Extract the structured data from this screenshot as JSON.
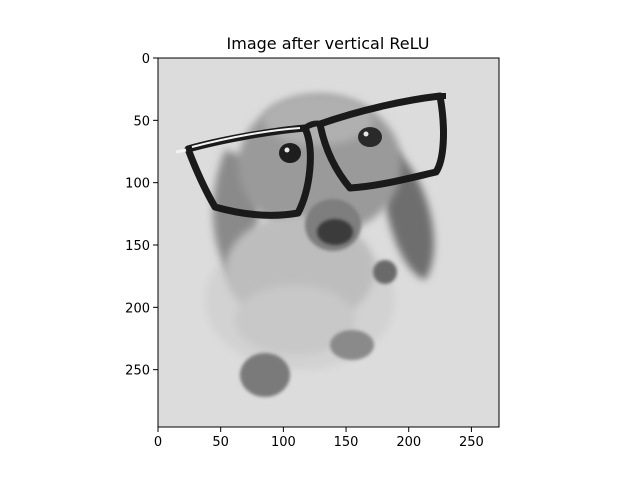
{
  "chart_data": {
    "type": "image",
    "title": "Image after vertical ReLU",
    "colormap": "gray",
    "image_content": "grayscale photo of a long-haired dachshund wearing oversized black-rimmed glasses, light gray background",
    "xlim": [
      0,
      272
    ],
    "ylim": [
      296,
      0
    ],
    "x_ticks": [
      0,
      50,
      100,
      150,
      200,
      250
    ],
    "y_ticks": [
      0,
      50,
      100,
      150,
      200,
      250
    ],
    "grid": false
  }
}
